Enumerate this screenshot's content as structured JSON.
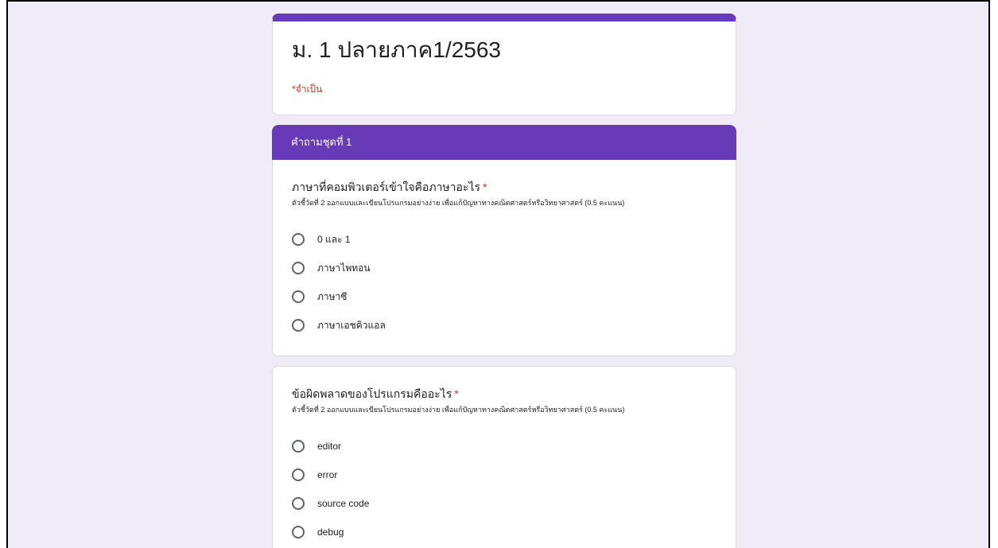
{
  "form": {
    "title": "ม. 1 ปลายภาค1/2563",
    "required_note": "*จำเป็น"
  },
  "section": {
    "header": "คำถามชุดที่ 1"
  },
  "questions": [
    {
      "title": "ภาษาที่คอมพิวเตอร์เข้าใจคือภาษาอะไร",
      "required": "*",
      "description": "ตัวชี้วัดที่ 2 ออกแบบและเขียนโปรแกรมอย่างง่าย เพื่อแก้ปัญหาทางคณิตศาสตร์หรือวิทยาศาสตร์ (0.5 คะแนน)",
      "options": [
        "0 และ 1",
        "ภาษาไพทอน",
        "ภาษาซี",
        "ภาษาเอชคิวแอล"
      ]
    },
    {
      "title": "ข้อผิดพลาดของโปรแกรมคืออะไร",
      "required": "*",
      "description": "ตัวชี้วัดที่ 2 ออกแบบและเขียนโปรแกรมอย่างง่าย เพื่อแก้ปัญหาทางคณิตศาสตร์หรือวิทยาศาสตร์ (0.5 คะแนน)",
      "options": [
        "editor",
        "error",
        "source code",
        "debug"
      ]
    }
  ],
  "colors": {
    "accent": "#673ab7",
    "background": "#efebf7",
    "required": "#d93025"
  }
}
